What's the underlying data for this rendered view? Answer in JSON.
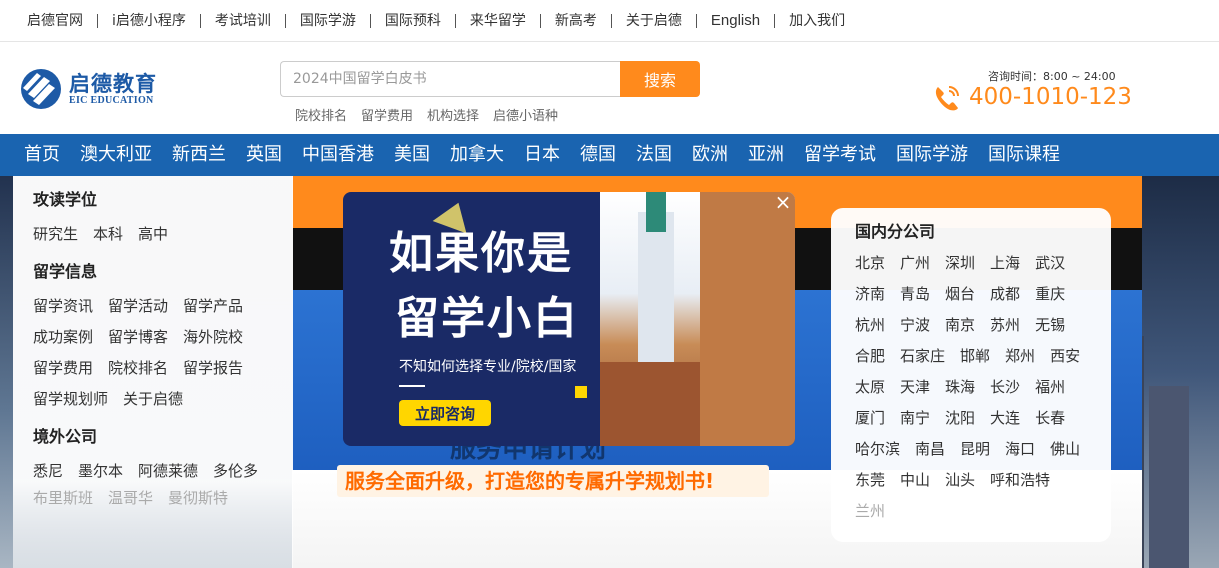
{
  "topbar": {
    "links": [
      "启德官网",
      "i启德小程序",
      "考试培训",
      "国际学游",
      "国际预科",
      "来华留学",
      "新高考",
      "关于启德",
      "English",
      "加入我们"
    ]
  },
  "header": {
    "logo_cn": "启德教育",
    "logo_en": "EIC EDUCATION",
    "search_placeholder": "2024中国留学白皮书",
    "search_button": "搜索",
    "hot_links": [
      "院校排名",
      "留学费用",
      "机构选择",
      "启德小语种"
    ],
    "hotline_time": "咨询时间：8:00 ~ 24:00",
    "hotline_number": "400-1010-123"
  },
  "nav": {
    "items": [
      "首页",
      "澳大利亚",
      "新西兰",
      "英国",
      "中国香港",
      "美国",
      "加拿大",
      "日本",
      "德国",
      "法国",
      "欧洲",
      "亚洲",
      "留学考试",
      "国际学游",
      "国际课程"
    ]
  },
  "left_panel": {
    "groups": [
      {
        "title": "攻读学位",
        "links": [
          "研究生",
          "本科",
          "高中"
        ]
      },
      {
        "title": "留学信息",
        "links": [
          "留学资讯",
          "留学活动",
          "留学产品",
          "成功案例",
          "留学博客",
          "海外院校",
          "留学费用",
          "院校排名",
          "留学报告",
          "留学规划师",
          "关于启德"
        ]
      },
      {
        "title": "境外公司",
        "links": [
          "悉尼",
          "墨尔本",
          "阿德莱德",
          "多伦多"
        ],
        "faded_links": [
          "布里斯班",
          "温哥华",
          "曼彻斯特"
        ]
      }
    ]
  },
  "right_panel": {
    "title": "国内分公司",
    "cities": [
      "北京",
      "广州",
      "深圳",
      "上海",
      "武汉",
      "济南",
      "青岛",
      "烟台",
      "成都",
      "重庆",
      "杭州",
      "宁波",
      "南京",
      "苏州",
      "无锡",
      "合肥",
      "石家庄",
      "邯郸",
      "郑州",
      "西安",
      "太原",
      "天津",
      "珠海",
      "长沙",
      "福州",
      "厦门",
      "南宁",
      "沈阳",
      "大连",
      "长春",
      "哈尔滨",
      "南昌",
      "昆明",
      "海口",
      "佛山",
      "东莞",
      "中山",
      "汕头",
      "呼和浩特"
    ],
    "faded_cities": [
      "兰州"
    ]
  },
  "banner": {
    "slogan": "服务全面升级，打造您的专属升学规划书!",
    "partial_text": "服务申请计划"
  },
  "popup": {
    "line1": "如果你是",
    "line2": "留学小白",
    "subtitle": "不知如何选择专业/院校/国家",
    "button": "立即咨询",
    "close": "×"
  },
  "colors": {
    "brand_blue": "#1a64b0",
    "accent_orange": "#ff8a1c",
    "popup_navy": "#1a2a66",
    "button_yellow": "#ffd600"
  }
}
